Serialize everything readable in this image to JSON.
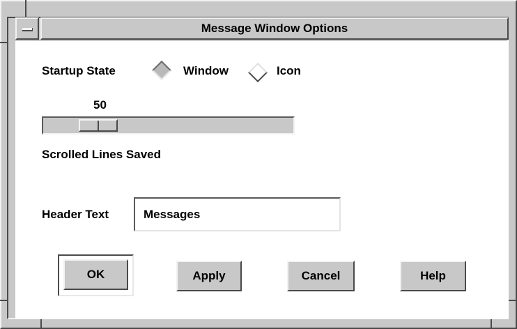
{
  "window": {
    "title": "Message Window Options"
  },
  "startup_state": {
    "label": "Startup State",
    "options": [
      {
        "label": "Window",
        "selected": true
      },
      {
        "label": "Icon",
        "selected": false
      }
    ]
  },
  "scrolled_lines": {
    "value": "50",
    "min": 0,
    "max": 300,
    "label": "Scrolled Lines Saved"
  },
  "header_text": {
    "label": "Header Text",
    "value": "Messages"
  },
  "buttons": {
    "ok": "OK",
    "apply": "Apply",
    "cancel": "Cancel",
    "help": "Help"
  },
  "colors": {
    "chrome": "#c8c8c8",
    "background": "#ffffff"
  }
}
